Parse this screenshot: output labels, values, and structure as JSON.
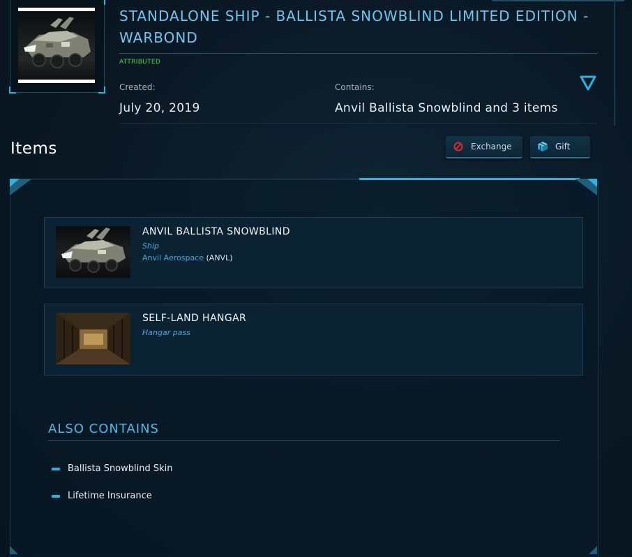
{
  "pledge": {
    "title": "STANDALONE SHIP - BALLISTA SNOWBLIND LIMITED EDITION - WARBOND",
    "status": "ATTRIBUTED",
    "created_label": "Created:",
    "created_value": "July 20, 2019",
    "contains_label": "Contains:",
    "contains_value": "Anvil Ballista Snowblind and 3 items"
  },
  "items_section": {
    "heading": "Items",
    "exchange_label": "Exchange",
    "gift_label": "Gift"
  },
  "items": [
    {
      "title": "ANVIL BALLISTA SNOWBLIND",
      "type": "Ship",
      "manufacturer": "Anvil Aerospace",
      "manufacturer_code": "(ANVL)"
    },
    {
      "title": "SELF-LAND HANGAR",
      "type": "Hangar pass"
    }
  ],
  "also_contains": {
    "heading": "ALSO CONTAINS",
    "items": [
      "Ballista Snowblind Skin",
      "Lifetime Insurance"
    ]
  },
  "colors": {
    "accent": "#2ab3e0",
    "title": "#6fc7f0",
    "attributed": "#3ce04a",
    "link": "#4aa6dc"
  },
  "icons": {
    "exchange": "exchange-icon",
    "gift": "gift-icon",
    "toggle": "chevron-down-icon"
  }
}
